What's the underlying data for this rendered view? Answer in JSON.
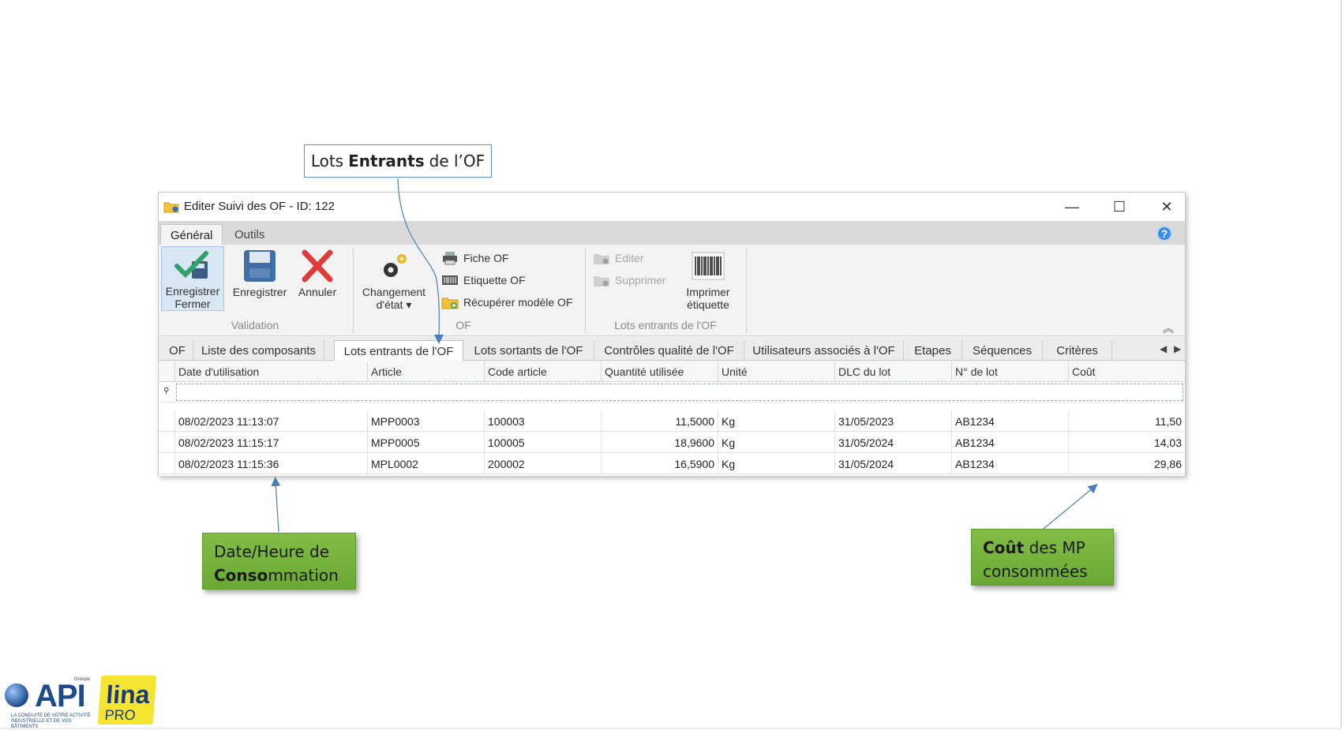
{
  "callouts": {
    "top": {
      "part1": "Lots",
      "bold": "Entrants",
      "part2": "de l’OF"
    },
    "left": {
      "line1": "Date/Heure de",
      "bold": "Conso",
      "rest": "mmation"
    },
    "right": {
      "bold": "Coût",
      "line1_rest": "des MP",
      "line2": "consommées"
    }
  },
  "window": {
    "title": "Editer Suivi des OF - ID: 122",
    "controls": {
      "minimize": "—",
      "maximize": "☐",
      "close": "✕"
    }
  },
  "ribbon_tabs": [
    "Général",
    "Outils"
  ],
  "ribbon": {
    "validation": {
      "label": "Validation",
      "save_close": {
        "line1": "Enregistrer",
        "line2": "Fermer"
      },
      "save": "Enregistrer",
      "cancel": "Annuler"
    },
    "of": {
      "label": "OF",
      "change_state": {
        "line1": "Changement",
        "line2": "d'état"
      },
      "fiche": "Fiche OF",
      "etiquette": "Etiquette OF",
      "recuperer": "Récupérer modèle OF"
    },
    "lots": {
      "label": "Lots entrants de l'OF",
      "edit": "Editer",
      "delete": "Supprimer",
      "print": {
        "line1": "Imprimer",
        "line2": "étiquette"
      }
    }
  },
  "doc_tabs": [
    "OF",
    "Liste des composants",
    "Lots entrants de l'OF",
    "Lots sortants de l'OF",
    "Contrôles qualité de l'OF",
    "Utilisateurs associés à l'OF",
    "Etapes",
    "Séquences",
    "Critères"
  ],
  "grid": {
    "columns": [
      "Date d'utilisation",
      "Article",
      "Code article",
      "Quantité utilisée",
      "Unité",
      "DLC du lot",
      "N° de lot",
      "Coût"
    ],
    "rows": [
      [
        "08/02/2023 11:13:07",
        "MPP0003",
        "100003",
        "11,5000",
        "Kg",
        "31/05/2023",
        "AB1234",
        "11,50"
      ],
      [
        "08/02/2023 11:15:17",
        "MPP0005",
        "100005",
        "18,9600",
        "Kg",
        "31/05/2024",
        "AB1234",
        "14,03"
      ],
      [
        "08/02/2023 11:15:36",
        "MPL0002",
        "200002",
        "16,5900",
        "Kg",
        "31/05/2024",
        "AB1234",
        "29,86"
      ]
    ]
  },
  "logos": {
    "api": {
      "text": "API",
      "groupe": "Groupe",
      "tagline": "LA CONDUITE DE VOTRE ACTIVITÉ INDUSTRIELLE ET DE VOS BÂTIMENTS"
    },
    "lina": {
      "text": "lina",
      "pro": "PRO"
    }
  },
  "colors": {
    "callout_green": "#7cb342",
    "callout_border": "#5b8fc9",
    "accent_blue": "#3a8ee6"
  }
}
